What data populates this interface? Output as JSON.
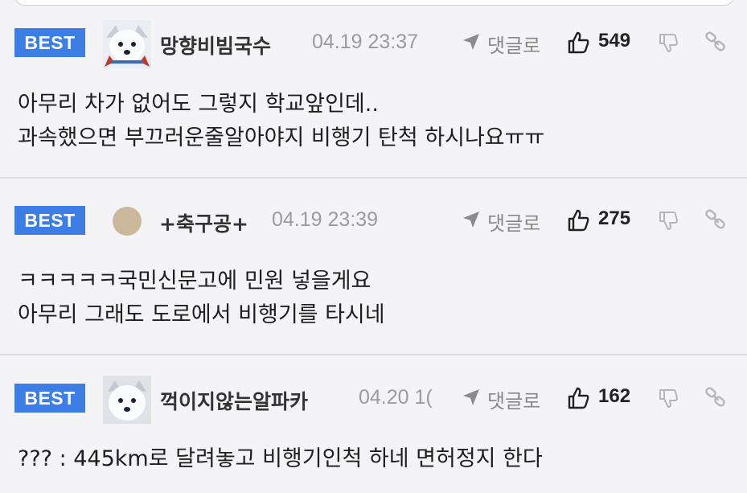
{
  "best_label": "BEST",
  "reply_label": "댓글로",
  "comments": [
    {
      "nickname": "망향비빔국수",
      "datetime": "04.19 23:37",
      "likes": "549",
      "avatar": "white-dog-icon",
      "lines": [
        "아무리 차가 없어도 그렇지 학교앞인데..",
        "과속했으면 부끄러운줄알아야지 비행기 탄척 하시나요ㅠㅠ"
      ]
    },
    {
      "nickname": "+축구공+",
      "datetime": "04.19 23:39",
      "likes": "275",
      "avatar": "beige-circle-avatar",
      "lines": [
        "ㅋㅋㅋㅋㅋ국민신문고에 민원 넣을게요",
        "아무리 그래도 도로에서 비행기를 타시네"
      ]
    },
    {
      "nickname": "꺽이지않는알파카",
      "datetime": "04.20 1(",
      "likes": "162",
      "avatar": "white-dog-icon",
      "lines": [
        "??? : 445km로 달려놓고 비행기인척 하네 면허정지 한다"
      ]
    }
  ],
  "colors": {
    "best_bg": "#3d7ee6",
    "date": "#9a9aa2",
    "divider": "#dcdcdf"
  }
}
